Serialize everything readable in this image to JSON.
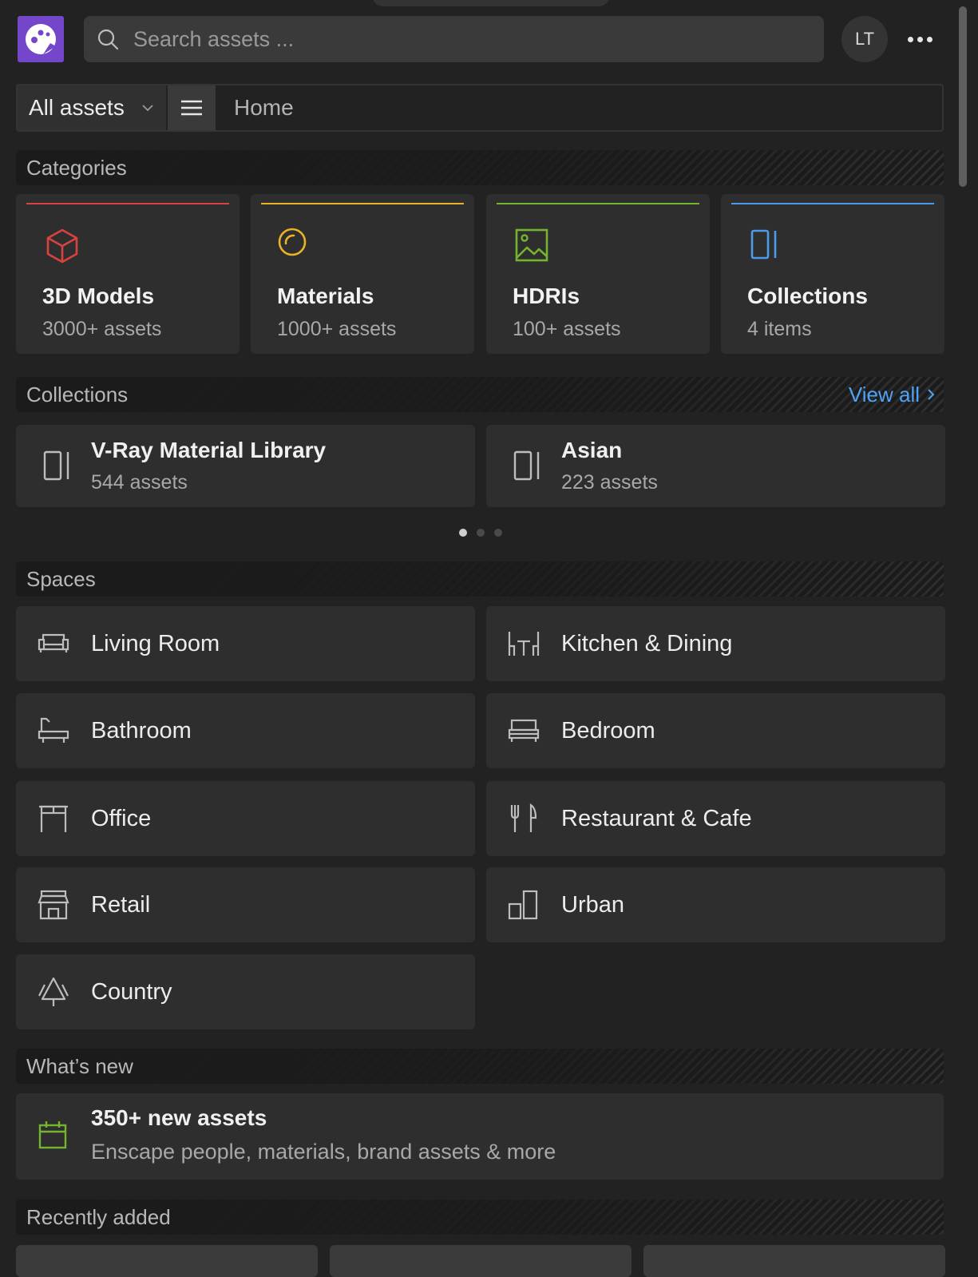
{
  "search": {
    "placeholder": "Search assets ..."
  },
  "user": {
    "initials": "LT"
  },
  "nav": {
    "filter_label": "All assets",
    "breadcrumb": "Home"
  },
  "sections": {
    "categories": "Categories",
    "collections": "Collections",
    "spaces": "Spaces",
    "whats_new": "What’s new",
    "recently_added": "Recently added"
  },
  "collections_view_all": "View all",
  "categories": [
    {
      "title": "3D Models",
      "subtitle": "3000+ assets",
      "accent": "#d9423f",
      "icon": "cube-icon"
    },
    {
      "title": "Materials",
      "subtitle": "1000+ assets",
      "accent": "#e8b326",
      "icon": "material-sphere-icon"
    },
    {
      "title": "HDRIs",
      "subtitle": "100+ assets",
      "accent": "#74b42e",
      "icon": "image-icon"
    },
    {
      "title": "Collections",
      "subtitle": "4 items",
      "accent": "#4c9be8",
      "icon": "collection-icon"
    }
  ],
  "collections": [
    {
      "title": "V-Ray Material Library",
      "subtitle": "544 assets",
      "icon": "collection-icon"
    },
    {
      "title": "Asian",
      "subtitle": "223 assets",
      "icon": "collection-icon"
    }
  ],
  "carousel": {
    "pages": 3,
    "active": 1
  },
  "spaces": [
    {
      "label": "Living Room",
      "icon": "sofa-icon"
    },
    {
      "label": "Kitchen & Dining",
      "icon": "dining-table-icon"
    },
    {
      "label": "Bathroom",
      "icon": "bathtub-icon"
    },
    {
      "label": "Bedroom",
      "icon": "bed-icon"
    },
    {
      "label": "Office",
      "icon": "desk-icon"
    },
    {
      "label": "Restaurant & Cafe",
      "icon": "cutlery-icon"
    },
    {
      "label": "Retail",
      "icon": "storefront-icon"
    },
    {
      "label": "Urban",
      "icon": "buildings-icon"
    },
    {
      "label": "Country",
      "icon": "trees-icon"
    }
  ],
  "whats_new": {
    "title": "350+ new assets",
    "subtitle": "Enscape people, materials, brand assets & more",
    "icon": "calendar-icon"
  },
  "colors": {
    "brand": "#7446c9",
    "link": "#4da3f5",
    "background": "#222222",
    "card": "#2e2e2e"
  }
}
